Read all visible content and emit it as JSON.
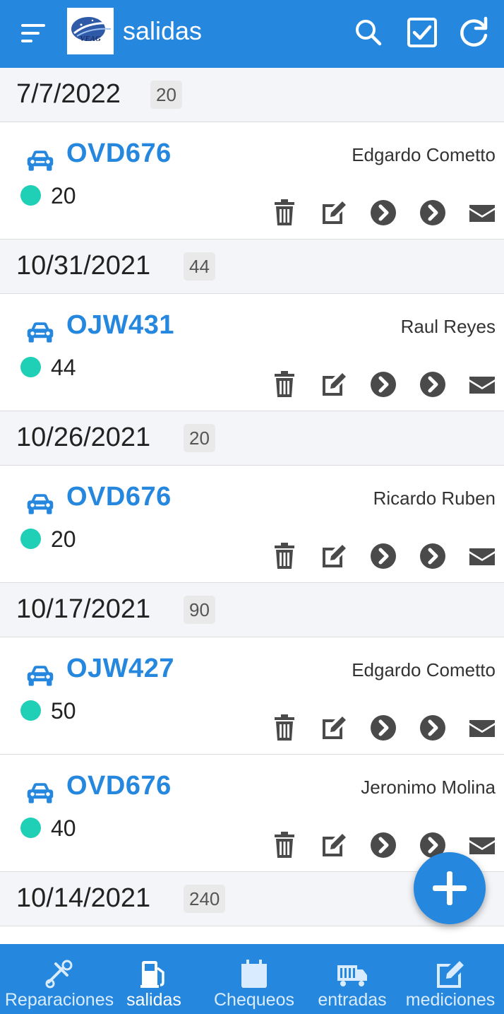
{
  "app": {
    "title": "salidas",
    "logo_text": "VEAG"
  },
  "colors": {
    "primary": "#2587dd",
    "status_dot": "#1fcfb6",
    "action_icon": "#4a4a4a"
  },
  "icons": {
    "menu": "sort-menu-icon",
    "search": "search-icon",
    "select": "checkbox-icon",
    "refresh": "refresh-icon",
    "vehicle": "car-icon",
    "delete": "trash-icon",
    "edit": "edit-icon",
    "next": "chevron-circle-icon",
    "mail": "envelope-icon",
    "add": "plus-icon"
  },
  "groups": [
    {
      "date": "7/7/2022",
      "count": "20",
      "items": [
        {
          "plate": "OVD676",
          "person": "Edgardo Cometto",
          "qty": "20"
        }
      ]
    },
    {
      "date": "10/31/2021",
      "count": "44",
      "items": [
        {
          "plate": "OJW431",
          "person": "Raul Reyes",
          "qty": "44"
        }
      ]
    },
    {
      "date": "10/26/2021",
      "count": "20",
      "items": [
        {
          "plate": "OVD676",
          "person": "Ricardo Ruben",
          "qty": "20"
        }
      ]
    },
    {
      "date": "10/17/2021",
      "count": "90",
      "items": [
        {
          "plate": "OJW427",
          "person": "Edgardo Cometto",
          "qty": "50"
        },
        {
          "plate": "OVD676",
          "person": "Jeronimo Molina",
          "qty": "40"
        }
      ]
    },
    {
      "date": "10/14/2021",
      "count": "240",
      "items": []
    }
  ],
  "bottom_nav": [
    {
      "label": "Reparaciones",
      "icon": "tools-icon",
      "active": false
    },
    {
      "label": "salidas",
      "icon": "fuel-pump-icon",
      "active": true
    },
    {
      "label": "Chequeos",
      "icon": "calendar-icon",
      "active": false
    },
    {
      "label": "entradas",
      "icon": "truck-icon",
      "active": false
    },
    {
      "label": "mediciones",
      "icon": "edit-icon",
      "active": false
    }
  ]
}
